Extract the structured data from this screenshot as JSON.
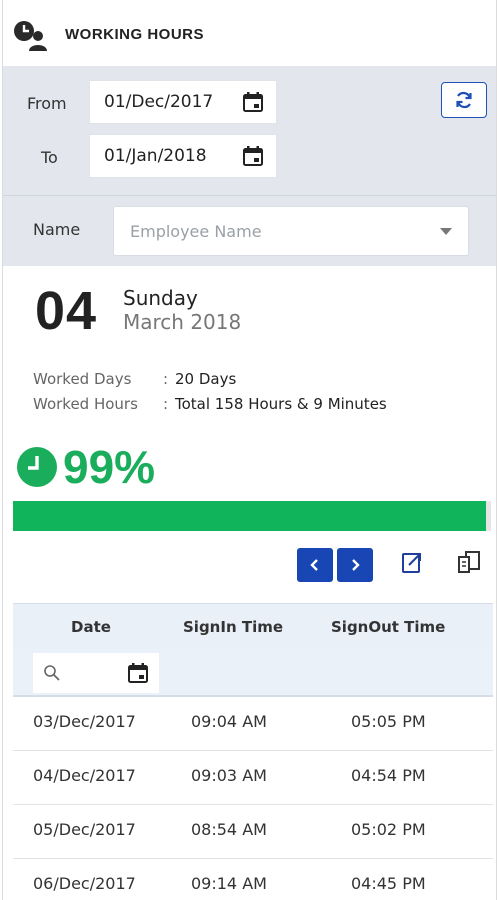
{
  "header": {
    "title": "WORKING HOURS",
    "logo_icon": "user-clock-icon"
  },
  "filter": {
    "from_label": "From",
    "to_label": "To",
    "from_value": "01/Dec/2017",
    "to_value": "01/Jan/2018",
    "name_label": "Name",
    "name_placeholder": "Employee Name",
    "refresh_icon": "refresh-icon"
  },
  "summary": {
    "day": "04",
    "weekday": "Sunday",
    "month_year": "March 2018",
    "worked_days_label": "Worked Days",
    "worked_days_value": "20 Days",
    "worked_hours_label": "Worked Hours",
    "worked_hours_value": "Total 158 Hours & 9 Minutes",
    "separator": ":",
    "percent_text": "99%",
    "progress": 0.99
  },
  "table": {
    "columns": [
      "Date",
      "SignIn Time",
      "SignOut Time"
    ],
    "rows": [
      [
        "03/Dec/2017",
        "09:04 AM",
        "05:05 PM"
      ],
      [
        "04/Dec/2017",
        "09:03 AM",
        "04:54 PM"
      ],
      [
        "05/Dec/2017",
        "08:54 AM",
        "05:02 PM"
      ],
      [
        "06/Dec/2017",
        "09:14 AM",
        "04:45 PM"
      ]
    ]
  },
  "colors": {
    "accent": "#1846b5",
    "success": "#10b45a",
    "filter_bg": "#e3e7ed"
  }
}
